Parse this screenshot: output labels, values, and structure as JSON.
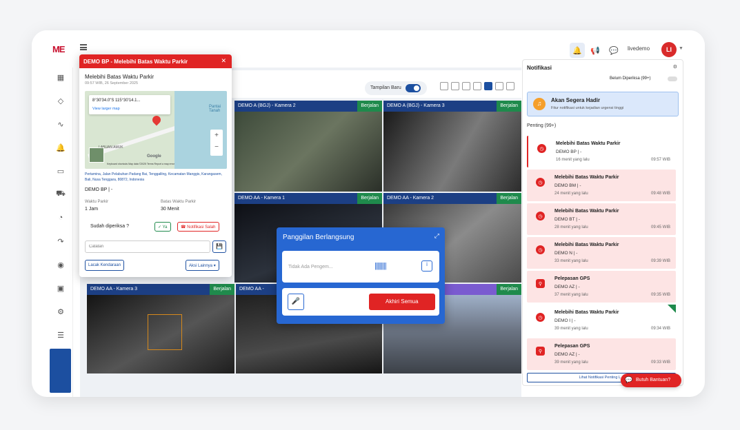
{
  "brand": {
    "logo_text": "ME"
  },
  "header": {
    "username": "livedemo",
    "avatar_initials": "LI"
  },
  "toolbar": {
    "view_toggle_label": "Tampilan Baru"
  },
  "cameras": [
    {
      "title": "DEMO A (BGJ) - Kamera 2",
      "status": "Berjalan"
    },
    {
      "title": "DEMO A (BGJ) - Kamera 3",
      "status": "Berjalan"
    },
    {
      "title": "DEMO AA - Kamera 1",
      "status": "Berjalan"
    },
    {
      "title": "DEMO AA - Kamera 2",
      "status": "Berjalan"
    },
    {
      "title": "DEMO AA - Kamera 3",
      "status": "Berjalan"
    },
    {
      "title": "DEMO AA -",
      "status": ""
    },
    {
      "title": "",
      "status": "Berjalan"
    }
  ],
  "alert_popup": {
    "header": "DEMO BP - Melebihi Batas Waktu Parkir",
    "title": "Melebihi Batas Waktu Parkir",
    "timestamp": "09:57 WIB, 26 September 2025",
    "map_coords": "8°30'34.0\"S 115°30'14.1...",
    "map_link": "View larger map",
    "map_place": "Pantai Tanah",
    "map_area": "LABUAN AMUK",
    "map_footer": "Keyboard shortcuts   Map data ©2025   Terms   Report a map error",
    "google": "Google",
    "address": "Pertamina, Jalan Pelabuhan Padang Bai, Tenggalilng, Kecamatan Manggis, Karangasem, Bali, Nusa Tenggara, 80872, Indonesia",
    "vehicle": "DEMO BP | -",
    "parking_label": "Waktu Parkir",
    "parking_value": "1 Jam",
    "limit_label": "Batas Waktu Parkir",
    "limit_value": "30 Menit",
    "checked_question": "Sudah diperiksa ?",
    "yes_label": "Ya",
    "false_label": "Notifikasi Salah",
    "notes_placeholder": "Catatan",
    "track_button": "Lacak Kendaraan",
    "more_button": "Aksi Lainnya"
  },
  "call_panel": {
    "title": "Panggilan Berlangsung",
    "empty_text": "Tidak Ada Pengem...",
    "end_all": "Akhiri Semua"
  },
  "notifications": {
    "title": "Notifikasi",
    "filter_label": "Belum Diperiksa (99+)",
    "banner_title": "Akan Segera Hadir",
    "banner_sub": "Fitur notifikasi untuk kejadian urgensi tinggi",
    "section": "Penting (99+)",
    "items": [
      {
        "title": "Melebihi Batas Waktu Parkir",
        "vehicle": "DEMO BP | -",
        "ago": "16 menit yang lalu",
        "time": "09:57 WIB"
      },
      {
        "title": "Melebihi Batas Waktu Parkir",
        "vehicle": "DEMO BM | -",
        "ago": "24 menit yang lalu",
        "time": "09:48 WIB"
      },
      {
        "title": "Melebihi Batas Waktu Parkir",
        "vehicle": "DEMO BT | -",
        "ago": "28 menit yang lalu",
        "time": "09:45 WIB"
      },
      {
        "title": "Melebihi Batas Waktu Parkir",
        "vehicle": "DEMO N | -",
        "ago": "33 menit yang lalu",
        "time": "09:39 WIB"
      },
      {
        "title": "Pelepasan GPS",
        "vehicle": "DEMO AZ | -",
        "ago": "37 menit yang lalu",
        "time": "09:35 WIB"
      },
      {
        "title": "Melebihi Batas Waktu Parkir",
        "vehicle": "DEMO I | -",
        "ago": "39 menit yang lalu",
        "time": "09:34 WIB"
      },
      {
        "title": "Pelepasan GPS",
        "vehicle": "DEMO AZ | -",
        "ago": "39 menit yang lalu",
        "time": "09:33 WIB"
      }
    ],
    "footer_link": "Lihat Notifikasi Penting L..."
  },
  "help_button": "Butuh Bantuan?",
  "colors": {
    "accent": "#1c4fa0",
    "alert": "#e02424",
    "running": "#1f8a4c"
  }
}
